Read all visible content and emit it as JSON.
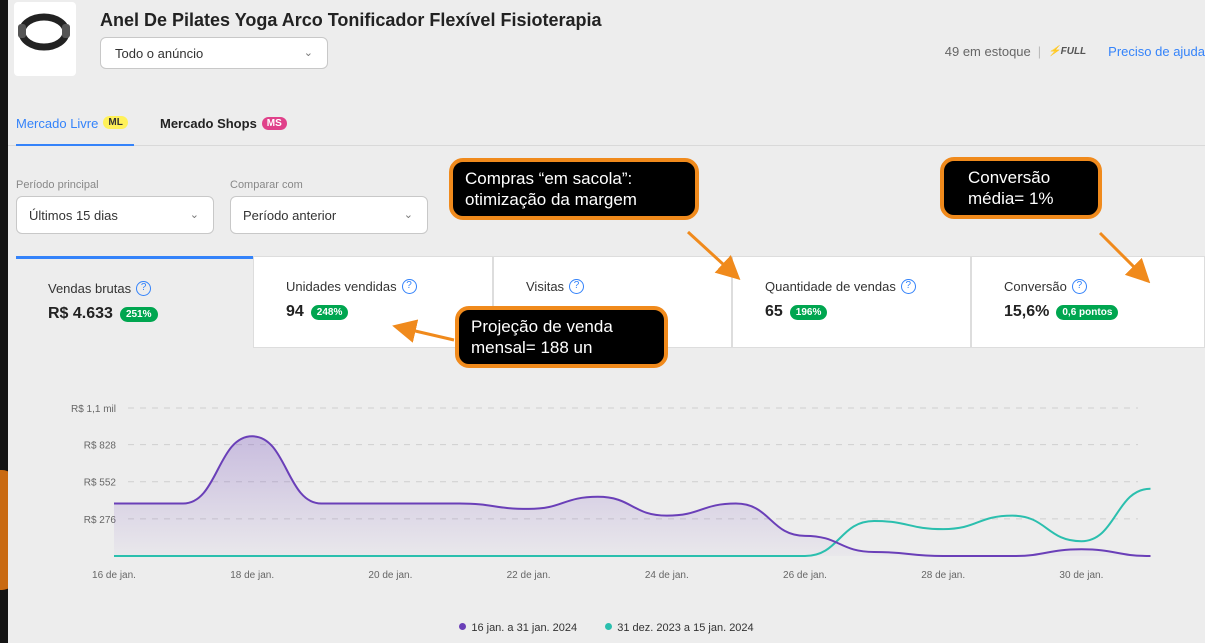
{
  "product": {
    "title": "Anel De Pilates Yoga Arco Tonificador Flexível Fisioterapia",
    "ad_filter": "Todo o anúncio",
    "stock": "49 em estoque",
    "full_label": "FULL",
    "help_link": "Preciso de ajuda"
  },
  "marketplace_tabs": [
    {
      "label": "Mercado Livre",
      "badge": "ML"
    },
    {
      "label": "Mercado Shops",
      "badge": "MS"
    }
  ],
  "filters": {
    "main_period_label": "Período principal",
    "main_period_value": "Últimos 15 dias",
    "compare_label": "Comparar com",
    "compare_value": "Período anterior"
  },
  "metrics": [
    {
      "label": "Vendas brutas",
      "value": "R$ 4.633",
      "change": "251%"
    },
    {
      "label": "Unidades vendidas",
      "value": "94",
      "change": "248%"
    },
    {
      "label": "Visitas",
      "value": "",
      "change": ""
    },
    {
      "label": "Quantidade de vendas",
      "value": "65",
      "change": "196%"
    },
    {
      "label": "Conversão",
      "value": "15,6%",
      "change": "0,6 pontos"
    }
  ],
  "callouts": {
    "sacola": "Compras “em sacola”: otimização da margem",
    "conversao": "Conversão média= 1%",
    "projecao": "Projeção de venda mensal= 188 un"
  },
  "colors": {
    "accent": "#3483fa",
    "positive": "#00a650",
    "series_current": "#6a3fb8",
    "series_previous": "#2bbfae",
    "callout_border": "#f08a1c"
  },
  "chart_data": {
    "type": "area",
    "x": [
      "16 de jan.",
      "17 de jan.",
      "18 de jan.",
      "19 de jan.",
      "20 de jan.",
      "21 de jan.",
      "22 de jan.",
      "23 de jan.",
      "24 de jan.",
      "25 de jan.",
      "26 de jan.",
      "27 de jan.",
      "28 de jan.",
      "29 de jan.",
      "30 de jan.",
      "31 de jan."
    ],
    "x_tick_labels": [
      "16 de jan.",
      "18 de jan.",
      "20 de jan.",
      "22 de jan.",
      "24 de jan.",
      "26 de jan.",
      "28 de jan.",
      "30 de jan."
    ],
    "y_tick_labels": [
      "R$ 1,1 mil",
      "R$ 828",
      "R$ 552",
      "R$ 276"
    ],
    "y_ticks": [
      1100,
      828,
      552,
      276
    ],
    "ylim": [
      0,
      1100
    ],
    "grid": true,
    "legend_position": "bottom-center",
    "series": [
      {
        "name": "16 jan. a 31 jan. 2024",
        "values": [
          390,
          390,
          890,
          390,
          390,
          390,
          350,
          440,
          300,
          390,
          150,
          30,
          0,
          0,
          50,
          0
        ]
      },
      {
        "name": "31 dez. 2023 a 15 jan. 2024",
        "values": [
          0,
          0,
          0,
          0,
          0,
          0,
          0,
          0,
          0,
          0,
          0,
          260,
          200,
          300,
          110,
          500
        ]
      }
    ]
  }
}
